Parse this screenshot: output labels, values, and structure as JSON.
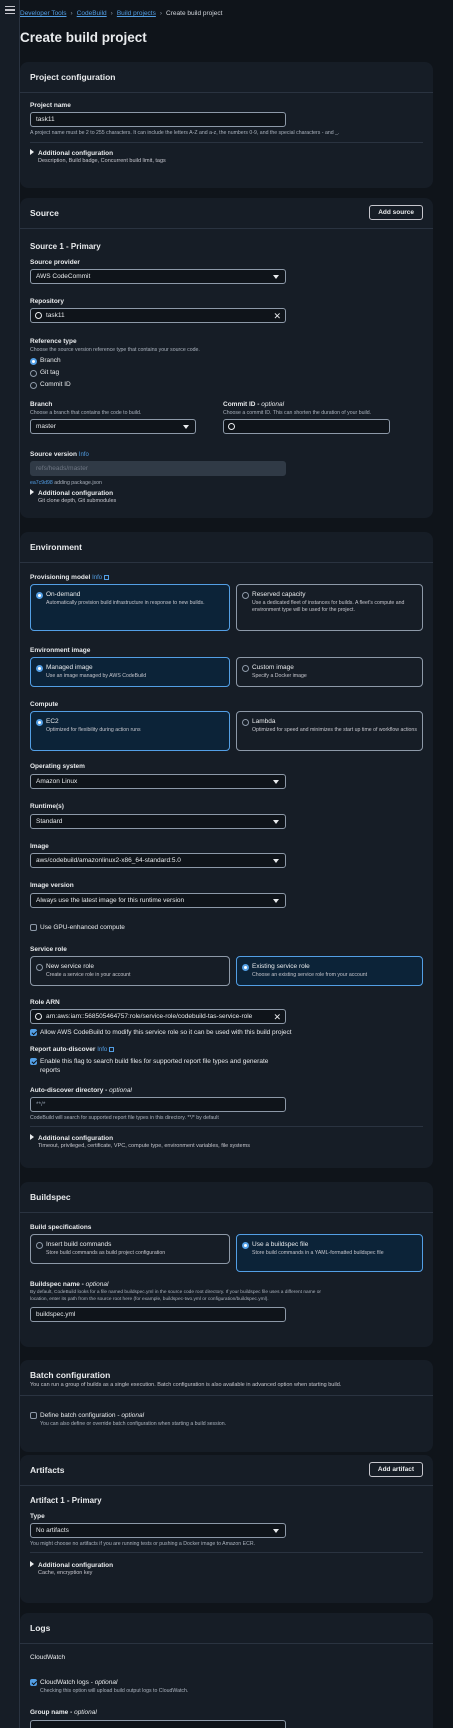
{
  "breadcrumbs": [
    "Developer Tools",
    "CodeBuild",
    "Build projects",
    "Create build project"
  ],
  "page_title": "Create build project",
  "project": {
    "title": "Project configuration",
    "name_label": "Project name",
    "name_value": "task11",
    "name_hint": "A project name must be 2 to 255 characters. It can include the letters A-Z and a-z, the numbers 0-9, and the special characters - and _.",
    "addl_label": "Additional configuration",
    "addl_sub": "Description, Build badge, Concurrent build limit, tags"
  },
  "source": {
    "title": "Source",
    "add_button": "Add source",
    "sub_title": "Source 1 - Primary",
    "provider_label": "Source provider",
    "provider_value": "AWS CodeCommit",
    "repo_label": "Repository",
    "repo_value": "task11",
    "ref_label": "Reference type",
    "ref_hint": "Choose the source version reference type that contains your source code.",
    "ref_options": [
      "Branch",
      "Git tag",
      "Commit ID"
    ],
    "branch_label": "Branch",
    "branch_hint": "Choose a branch that contains the code to build.",
    "branch_value": "master",
    "commit_label": "Commit ID",
    "commit_optional": "optional",
    "commit_hint": "Choose a commit ID. This can shorten the duration of your build.",
    "version_label": "Source version",
    "version_info": "Info",
    "version_value": "refs/heads/master",
    "commit_hash": "ea7c9d98",
    "commit_msg": "adding package.json",
    "addl_label": "Additional configuration",
    "addl_sub": "Git clone depth, Git submodules"
  },
  "environment": {
    "title": "Environment",
    "prov_label": "Provisioning model",
    "prov_info": "Info",
    "ondemand_title": "On-demand",
    "ondemand_desc": "Automatically provision build infrastructure in response to new builds.",
    "reserved_title": "Reserved capacity",
    "reserved_desc": "Use a dedicated fleet of instances for builds. A fleet's compute and environment type will be used for the project.",
    "img_label": "Environment image",
    "managed_title": "Managed image",
    "managed_desc": "Use an image managed by AWS CodeBuild",
    "custom_title": "Custom image",
    "custom_desc": "Specify a Docker image",
    "compute_label": "Compute",
    "ec2_title": "EC2",
    "ec2_desc": "Optimized for flexibility during action runs",
    "lambda_title": "Lambda",
    "lambda_desc": "Optimized for speed and minimizes the start up time of workflow actions",
    "os_label": "Operating system",
    "os_value": "Amazon Linux",
    "runtime_label": "Runtime(s)",
    "runtime_value": "Standard",
    "image_label": "Image",
    "image_value": "aws/codebuild/amazonlinux2-x86_64-standard:5.0",
    "imgver_label": "Image version",
    "imgver_value": "Always use the latest image for this runtime version",
    "gpu_label": "Use GPU-enhanced compute",
    "role_label": "Service role",
    "newrole_title": "New service role",
    "newrole_desc": "Create a service role in your account",
    "exrole_title": "Existing service role",
    "exrole_desc": "Choose an existing service role from your account",
    "arn_label": "Role ARN",
    "arn_value": "arn:aws:iam::568505464757:role/service-role/codebuild-tas-service-role",
    "allow_label": "Allow AWS CodeBuild to modify this service role so it can be used with this build project",
    "report_label": "Report auto-discover",
    "report_info": "Info",
    "report_cb": "Enable this flag to search build files for supported report file types and generate reports",
    "dir_label": "Auto-discover directory",
    "dir_optional": "optional",
    "dir_placeholder": "**/*",
    "dir_hint": "CodeBuild will search for supported report file types in this directory. **/* by default",
    "addl_label": "Additional configuration",
    "addl_sub": "Timeout, privileged, certificate, VPC, compute type, environment variables, file systems"
  },
  "buildspec": {
    "title": "Buildspec",
    "spec_label": "Build specifications",
    "insert_title": "Insert build commands",
    "insert_desc": "Store build commands as build project configuration",
    "use_title": "Use a buildspec file",
    "use_desc": "Store build commands in a YAML-formatted buildspec file",
    "name_label": "Buildspec name",
    "name_optional": "optional",
    "name_hint1": "By default, CodeBuild looks for a file named buildspec.yml in the source code root directory. If your buildspec file uses a different name or",
    "name_hint2": "location, enter its path from the source root here (for example, buildspec-two.yml or configuration/buildspec.yml).",
    "name_value": "buildspec.yml"
  },
  "batch": {
    "title": "Batch configuration",
    "sub": "You can run a group of builds as a single execution. Batch configuration is also available in advanced option when starting build.",
    "cb_label": "Define batch configuration",
    "cb_optional": "optional",
    "cb_desc": "You can also define or override batch configuration when starting a build session."
  },
  "artifacts": {
    "title": "Artifacts",
    "add_button": "Add artifact",
    "sub_title": "Artifact 1 - Primary",
    "type_label": "Type",
    "type_value": "No artifacts",
    "type_hint": "You might choose no artifacts if you are running tests or pushing a Docker image to Amazon ECR.",
    "addl_label": "Additional configuration",
    "addl_sub": "Cache, encryption key"
  },
  "logs": {
    "title": "Logs",
    "cw_title": "CloudWatch",
    "cw_label": "CloudWatch logs",
    "cw_optional": "optional",
    "cw_desc": "Checking this option will upload build output logs to CloudWatch.",
    "group_label": "Group name",
    "group_optional": "optional"
  },
  "colors": {
    "accent": "#539fe5",
    "bg": "#0f141a",
    "card": "#161d26"
  }
}
